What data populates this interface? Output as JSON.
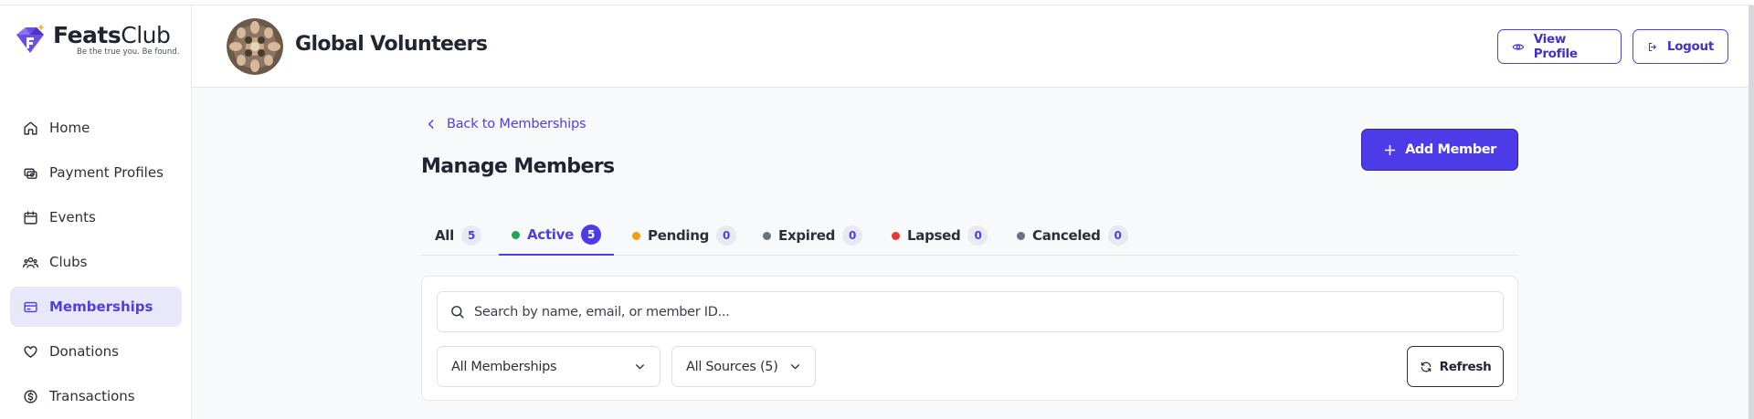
{
  "brand": {
    "name_bold": "Feats",
    "name_light": "Club",
    "tagline": "Be the true you. Be found."
  },
  "sidebar": {
    "items": [
      {
        "label": "Home",
        "icon": "home-icon"
      },
      {
        "label": "Payment Profiles",
        "icon": "payment-icon"
      },
      {
        "label": "Events",
        "icon": "calendar-icon"
      },
      {
        "label": "Clubs",
        "icon": "users-icon"
      },
      {
        "label": "Memberships",
        "icon": "membership-card-icon",
        "active": true
      },
      {
        "label": "Donations",
        "icon": "heart-icon"
      },
      {
        "label": "Transactions",
        "icon": "dollar-circle-icon"
      }
    ]
  },
  "header": {
    "org_name": "Global Volunteers",
    "view_profile_label": "View Profile",
    "logout_label": "Logout"
  },
  "main": {
    "back_label": "Back to Memberships",
    "title": "Manage Members",
    "add_member_label": "Add Member",
    "tabs": [
      {
        "label": "All",
        "count": "5"
      },
      {
        "label": "Active",
        "count": "5",
        "dot_color": "#22a55a",
        "active": true
      },
      {
        "label": "Pending",
        "count": "0",
        "dot_color": "#f0a010"
      },
      {
        "label": "Expired",
        "count": "0",
        "dot_color": "#6b7280"
      },
      {
        "label": "Lapsed",
        "count": "0",
        "dot_color": "#e53935"
      },
      {
        "label": "Canceled",
        "count": "0",
        "dot_color": "#6b7280"
      }
    ],
    "search_placeholder": "Search by name, email, or member ID...",
    "membership_filter": "All Memberships",
    "source_filter": "All Sources (5)",
    "refresh_label": "Refresh"
  },
  "colors": {
    "accent": "#4c3be6",
    "active_nav_bg": "#e9e8fb"
  }
}
